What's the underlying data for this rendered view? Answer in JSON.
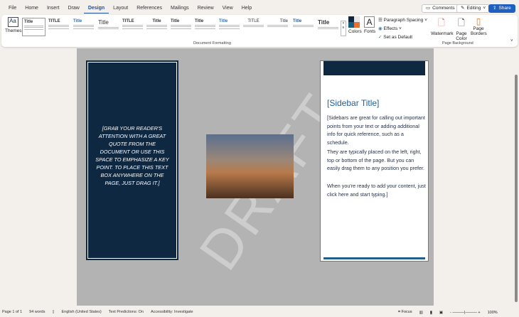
{
  "tabs": [
    "File",
    "Home",
    "Insert",
    "Draw",
    "Design",
    "Layout",
    "References",
    "Mailings",
    "Review",
    "View",
    "Help"
  ],
  "top_buttons": {
    "comments": "Comments",
    "editing": "Editing",
    "share": "Share"
  },
  "ribbon": {
    "themes": "Themes",
    "styles": [
      "Title",
      "TITLE",
      "Title",
      "Title",
      "TITLE",
      "Title",
      "Title",
      "Title",
      "Title",
      "TITLE",
      "Title",
      "Title",
      "Title"
    ],
    "document_formatting": "Document Formatting",
    "colors": "Colors",
    "fonts": "Fonts",
    "paragraph_spacing": "Paragraph Spacing",
    "effects": "Effects",
    "set_default": "Set as Default",
    "watermark": "Watermark",
    "page_color": "Page Color",
    "page_borders": "Page Borders",
    "page_background": "Page Background"
  },
  "document": {
    "watermark": "DRAFT",
    "quote": "[Grab your reader's attention with a great quote from the document or use this space to emphasize a key point. To place this text box anywhere on the page, just drag it.]",
    "sidebar_title": "[Sidebar Title]",
    "sidebar_p1": "[Sidebars are great for calling out important points from your text or adding additional info for quick reference, such as a schedule.",
    "sidebar_p2": "They are typically placed on the left, right, top or bottom of the page. But you can easily drag them to any position you prefer.",
    "sidebar_p3": "When you're ready to add your content, just click here and start typing.]"
  },
  "status": {
    "page": "Page 1 of 1",
    "words": "94 words",
    "language": "English (United States)",
    "predictions": "Text Predictions: On",
    "accessibility": "Accessibility: Investigate",
    "focus": "Focus",
    "zoom": "100%"
  }
}
